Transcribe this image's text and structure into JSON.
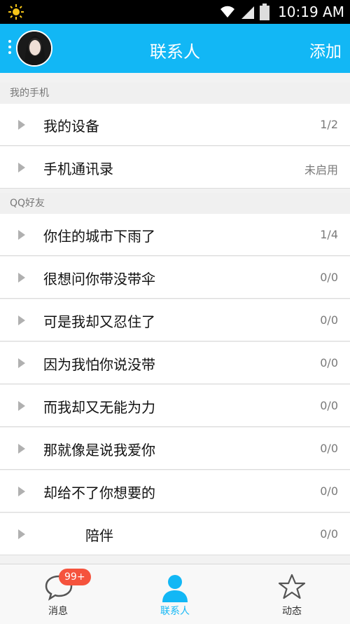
{
  "status_bar": {
    "time": "10:19 AM"
  },
  "header": {
    "title": "联系人",
    "add_label": "添加"
  },
  "sections": [
    {
      "name": "我的手机",
      "items": [
        {
          "label": "我的设备",
          "count": "1/2"
        },
        {
          "label": "手机通讯录",
          "count": "未启用"
        }
      ]
    },
    {
      "name": "QQ好友",
      "items": [
        {
          "label": "你住的城市下雨了",
          "count": "1/4"
        },
        {
          "label": "很想问你带没带伞",
          "count": "0/0"
        },
        {
          "label": "可是我却又忍住了",
          "count": "0/0"
        },
        {
          "label": "因为我怕你说没带",
          "count": "0/0"
        },
        {
          "label": "而我却又无能为力",
          "count": "0/0"
        },
        {
          "label": "那就像是说我爱你",
          "count": "0/0"
        },
        {
          "label": "却给不了你想要的",
          "count": "0/0"
        },
        {
          "label": "陪伴",
          "count": "0/0"
        }
      ]
    }
  ],
  "bottom_nav": {
    "tabs": [
      {
        "label": "消息",
        "icon": "chat-bubble-icon"
      },
      {
        "label": "联系人",
        "icon": "person-icon"
      },
      {
        "label": "动态",
        "icon": "star-icon"
      }
    ],
    "badge": "99+"
  },
  "colors": {
    "accent": "#12b7f5",
    "badge": "#f5533d",
    "status_bar": "#000000"
  }
}
